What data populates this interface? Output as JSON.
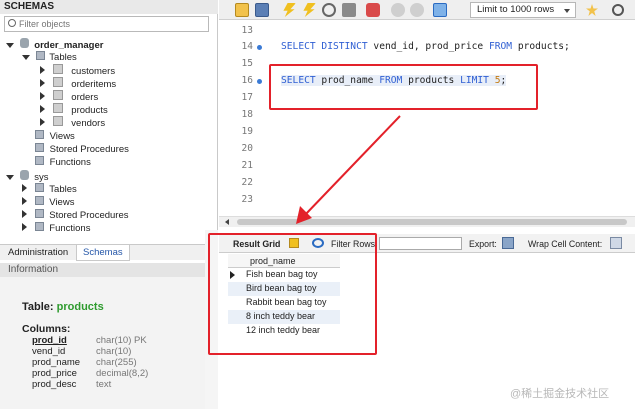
{
  "schemas_panel": {
    "title": "SCHEMAS",
    "filter_placeholder": "Filter objects",
    "tree": {
      "order_manager": "order_manager",
      "tables": "Tables",
      "table_items": [
        "customers",
        "orderitems",
        "orders",
        "products",
        "vendors"
      ],
      "views": "Views",
      "stored_procedures": "Stored Procedures",
      "functions": "Functions",
      "sys": "sys",
      "sys_tables": "Tables",
      "sys_views": "Views",
      "sys_stored_procedures": "Stored Procedures",
      "sys_functions": "Functions"
    },
    "tabs": [
      "Administration",
      "Schemas"
    ],
    "info_header": "Information",
    "info": {
      "table_label": "Table:",
      "table_name": "products",
      "columns_label": "Columns:",
      "columns": [
        {
          "name": "prod_id",
          "type": "char(10) PK"
        },
        {
          "name": "vend_id",
          "type": "char(10)"
        },
        {
          "name": "prod_name",
          "type": "char(255)"
        },
        {
          "name": "prod_price",
          "type": "decimal(8,2)"
        },
        {
          "name": "prod_desc",
          "type": "text"
        }
      ]
    }
  },
  "toolbar": {
    "limit_label": "Limit to 1000 rows"
  },
  "editor": {
    "lines": [
      {
        "num": "13",
        "code": ""
      },
      {
        "num": "14",
        "code": "SELECT DISTINCT vend_id, prod_price FROM products;"
      },
      {
        "num": "15",
        "code": ""
      },
      {
        "num": "16",
        "code": "SELECT prod_name FROM products LIMIT 5;"
      },
      {
        "num": "17",
        "code": ""
      },
      {
        "num": "18",
        "code": ""
      },
      {
        "num": "19",
        "code": ""
      },
      {
        "num": "20",
        "code": ""
      },
      {
        "num": "21",
        "code": ""
      },
      {
        "num": "22",
        "code": ""
      },
      {
        "num": "23",
        "code": ""
      }
    ]
  },
  "result": {
    "tab_label": "Result Grid",
    "filter_rows_label": "Filter Rows:",
    "export_label": "Export:",
    "wrap_label": "Wrap Cell Content:",
    "column_header": "prod_name",
    "rows": [
      "Fish bean bag toy",
      "Bird bean bag toy",
      "Rabbit bean bag toy",
      "8 inch teddy bear",
      "12 inch teddy bear"
    ]
  },
  "watermark": "@稀土掘金技术社区",
  "colors": {
    "annotation_red": "#e3212a",
    "keyword_blue": "#2f5fd3"
  }
}
